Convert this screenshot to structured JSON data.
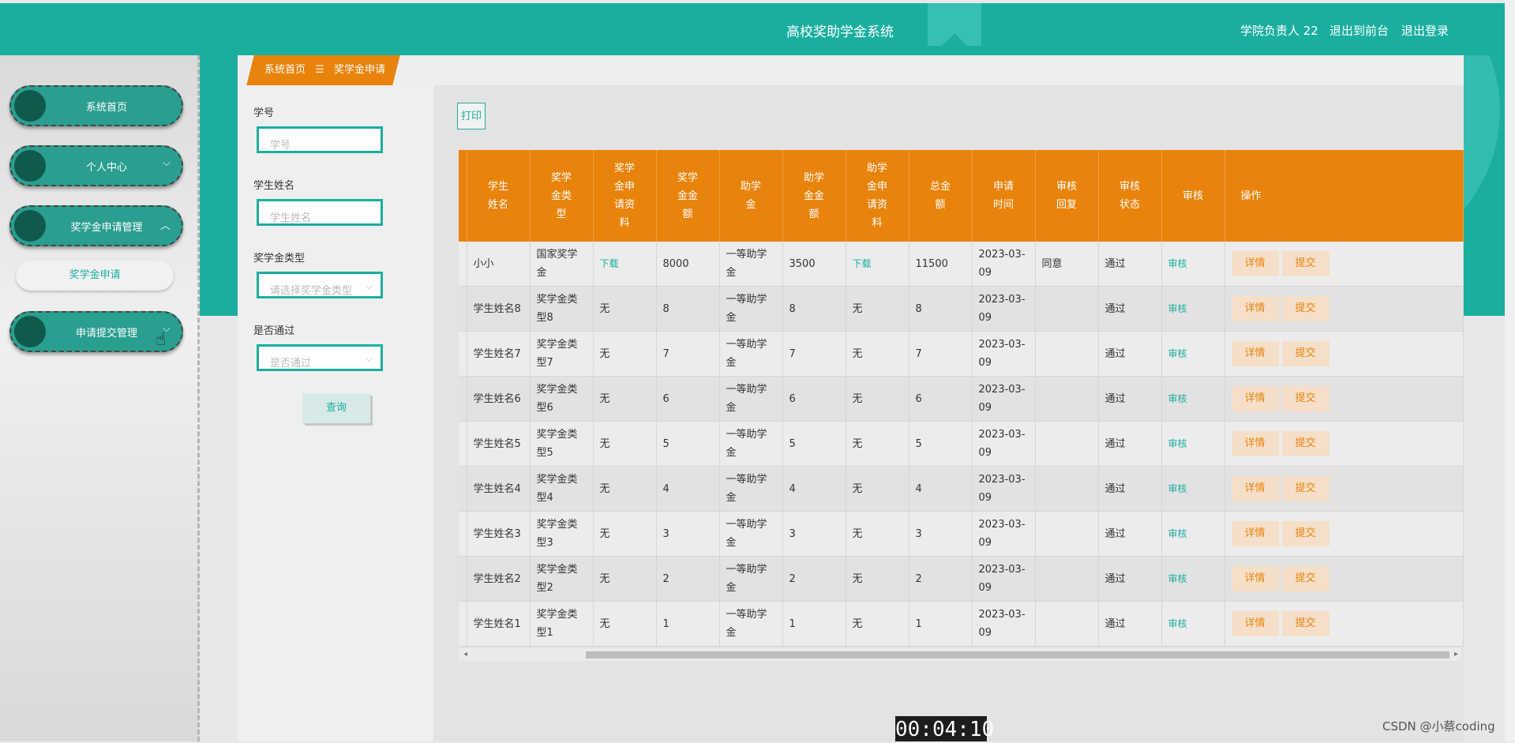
{
  "header": {
    "title": "高校奖助学金系统",
    "user": "学院负责人 22",
    "back_front": "退出到前台",
    "logout": "退出登录"
  },
  "sidebar": {
    "items": [
      {
        "label": "系统首页"
      },
      {
        "label": "个人中心",
        "chevron": "⌵"
      },
      {
        "label": "奖学金申请管理",
        "chevron": "︿"
      },
      {
        "label": "申请提交管理",
        "chevron": "⌵"
      }
    ],
    "subitems": [
      {
        "label": "奖学金申请"
      }
    ]
  },
  "breadcrumb": {
    "home": "系统首页",
    "separator": "☰",
    "current": "奖学金申请"
  },
  "search": {
    "student_no_label": "学号",
    "student_no_placeholder": "学号",
    "student_name_label": "学生姓名",
    "student_name_placeholder": "学生姓名",
    "type_label": "奖学金类型",
    "type_placeholder": "请选择奖学金类型",
    "pass_label": "是否通过",
    "pass_placeholder": "是否通过",
    "query_button": "查询"
  },
  "toolbar": {
    "print_label": "打印"
  },
  "table": {
    "headers": [
      "",
      "学生\n姓名",
      "奖学\n金类\n型",
      "奖学\n金申\n请资\n料",
      "奖学\n金金\n额",
      "助学\n金",
      "助学\n金金\n额",
      "助学\n金申\n请资\n料",
      "总金\n额",
      "申请\n时间",
      "审核\n回复",
      "审核\n状态",
      "审核",
      "操作"
    ],
    "detail_label": "详情",
    "submit_label": "提交",
    "rows": [
      [
        "小小",
        "国家奖学金",
        "下载",
        "8000",
        "一等助学金",
        "3500",
        "下载",
        "11500",
        "2023-03-09",
        "同意",
        "通过",
        "审核"
      ],
      [
        "学生姓名8",
        "奖学金类型8",
        "无",
        "8",
        "一等助学金",
        "8",
        "无",
        "8",
        "2023-03-09",
        "",
        "通过",
        "审核"
      ],
      [
        "学生姓名7",
        "奖学金类型7",
        "无",
        "7",
        "一等助学金",
        "7",
        "无",
        "7",
        "2023-03-09",
        "",
        "通过",
        "审核"
      ],
      [
        "学生姓名6",
        "奖学金类型6",
        "无",
        "6",
        "一等助学金",
        "6",
        "无",
        "6",
        "2023-03-09",
        "",
        "通过",
        "审核"
      ],
      [
        "学生姓名5",
        "奖学金类型5",
        "无",
        "5",
        "一等助学金",
        "5",
        "无",
        "5",
        "2023-03-09",
        "",
        "通过",
        "审核"
      ],
      [
        "学生姓名4",
        "奖学金类型4",
        "无",
        "4",
        "一等助学金",
        "4",
        "无",
        "4",
        "2023-03-09",
        "",
        "通过",
        "审核"
      ],
      [
        "学生姓名3",
        "奖学金类型3",
        "无",
        "3",
        "一等助学金",
        "3",
        "无",
        "3",
        "2023-03-09",
        "",
        "通过",
        "审核"
      ],
      [
        "学生姓名2",
        "奖学金类型2",
        "无",
        "2",
        "一等助学金",
        "2",
        "无",
        "2",
        "2023-03-09",
        "",
        "通过",
        "审核"
      ],
      [
        "学生姓名1",
        "奖学金类型1",
        "无",
        "1",
        "一等助学金",
        "1",
        "无",
        "1",
        "2023-03-09",
        "",
        "通过",
        "审核"
      ]
    ]
  },
  "overlay": {
    "timer": "00:04:10",
    "watermark": "CSDN @小蔡coding"
  },
  "colors": {
    "teal": "#1aae9f",
    "orange": "#e8830c"
  }
}
